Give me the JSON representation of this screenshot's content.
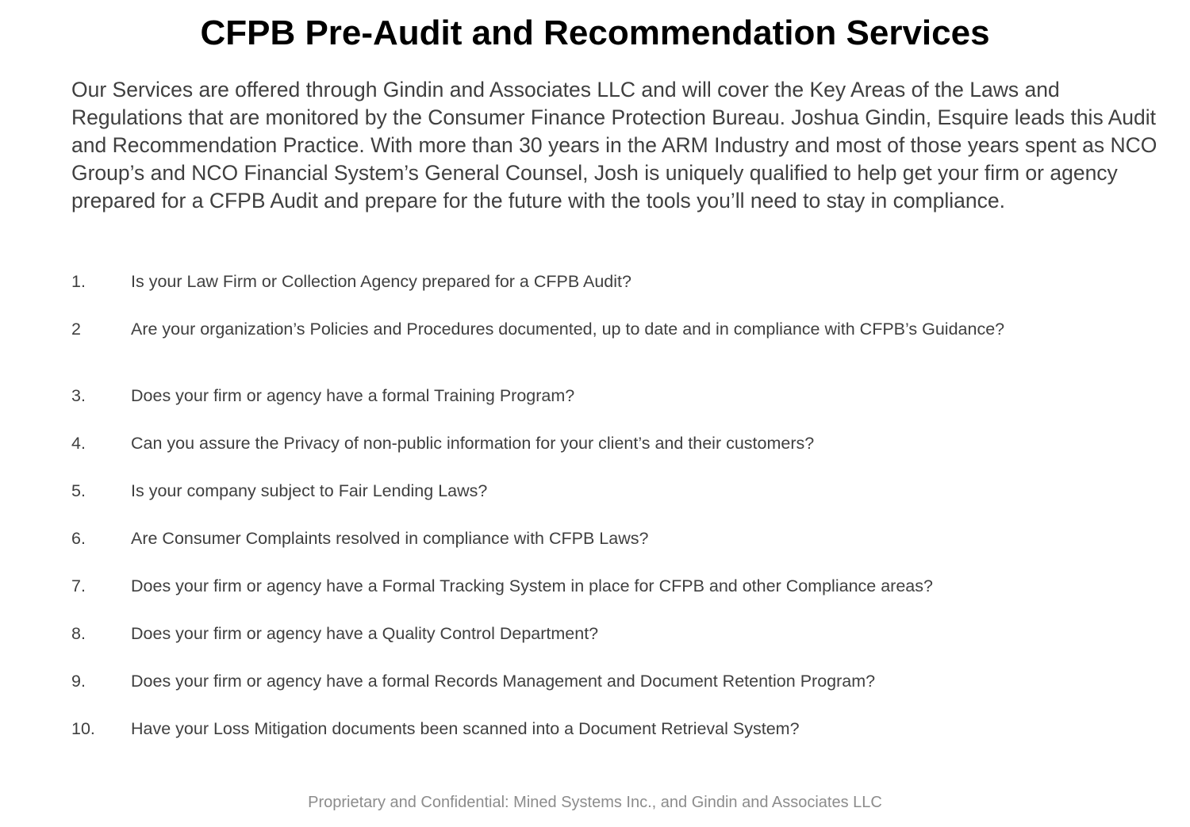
{
  "title": "CFPB Pre-Audit and Recommendation Services",
  "intro": "Our Services are offered through Gindin and Associates LLC and will cover the Key Areas of the Laws and Regulations that are monitored by the Consumer Finance Protection Bureau.  Joshua Gindin, Esquire leads this Audit and Recommendation Practice.  With more than 30 years in the ARM Industry and most of those years spent as NCO Group’s and NCO Financial System’s General Counsel, Josh is uniquely qualified to help get your firm or agency prepared for a CFPB Audit and prepare for the future with the tools you’ll need to stay in compliance.",
  "questions": [
    {
      "num": "1.",
      "text": "Is your Law Firm or Collection Agency prepared for a CFPB Audit?"
    },
    {
      "num": "2",
      "text": "Are your organization’s Policies and Procedures documented, up to date and in compliance with CFPB’s Guidance?"
    },
    {
      "num": "3.",
      "text": "Does your firm or agency have a formal Training Program?"
    },
    {
      "num": "4.",
      "text": "Can you assure the Privacy of non-public information for your client’s and their customers?"
    },
    {
      "num": "5.",
      "text": "Is your company subject to Fair Lending Laws?"
    },
    {
      "num": "6.",
      "text": "Are Consumer Complaints resolved in compliance with CFPB Laws?"
    },
    {
      "num": "7.",
      "text": "Does your firm or agency have a Formal Tracking System in place for CFPB and other Compliance areas?"
    },
    {
      "num": "8.",
      "text": "Does your firm or agency have a Quality Control Department?"
    },
    {
      "num": "9.",
      "text": "Does your firm or agency have a formal Records Management and Document Retention Program?"
    },
    {
      "num": "10.",
      "text": "Have your Loss Mitigation documents been scanned into a Document Retrieval System?"
    }
  ],
  "footer": "Proprietary and Confidential: Mined Systems Inc., and Gindin and Associates LLC"
}
